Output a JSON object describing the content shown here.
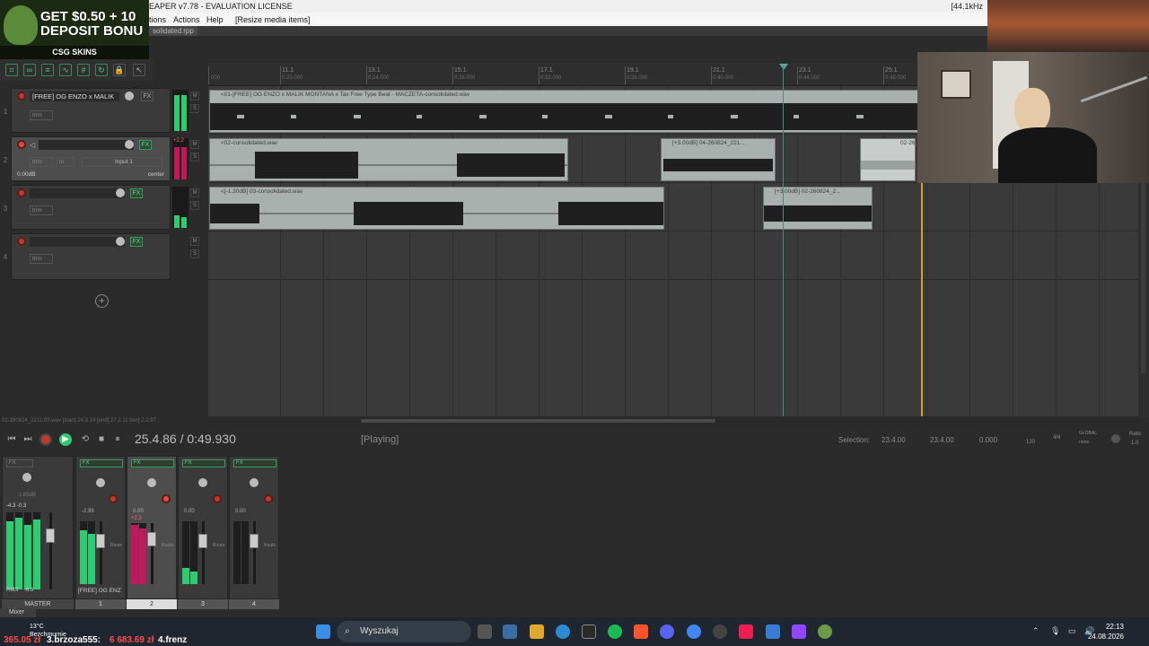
{
  "window": {
    "title": "EAPER v7.78 - EVALUATION LICENSE",
    "sample_rate": "[44.1kHz"
  },
  "menu": {
    "items": [
      "tions",
      "Actions",
      "Help",
      "[Resize media items]"
    ]
  },
  "project_tab": "solidated.rpp",
  "ad": {
    "line1": "GET $0.50 + 10",
    "line2": "DEPOSIT BONU",
    "brand": "CSG SKINS"
  },
  "ruler": {
    "marks": [
      {
        "label": "",
        "time": "000"
      },
      {
        "label": "11.1",
        "time": "0:20.000"
      },
      {
        "label": "13.1",
        "time": "0:24.000"
      },
      {
        "label": "15.1",
        "time": "0:28.000"
      },
      {
        "label": "17.1",
        "time": "0:32.000"
      },
      {
        "label": "19.1",
        "time": "0:36.000"
      },
      {
        "label": "21.1",
        "time": "0:40.000"
      },
      {
        "label": "23.1",
        "time": "0:44.000"
      },
      {
        "label": "25.1",
        "time": "0:48.000"
      }
    ]
  },
  "tracks": [
    {
      "num": "1",
      "name": "[FREE] OG ENZO x MALIK",
      "volume": "",
      "pan": "",
      "input": "",
      "trim": "trim",
      "fx": "FX"
    },
    {
      "num": "2",
      "name": "",
      "volume": "0.00dB",
      "pan": "center",
      "input": "Input 1",
      "trim": "trim",
      "fx": "FX",
      "meter_peak": "+2.2"
    },
    {
      "num": "3",
      "name": "",
      "volume": "",
      "pan": "",
      "input": "",
      "trim": "trim",
      "fx": "FX"
    },
    {
      "num": "4",
      "name": "",
      "volume": "",
      "pan": "",
      "input": "",
      "trim": "trim",
      "fx": "FX"
    }
  ],
  "items": [
    {
      "name": "<01-[FREE] OG ENZO x MALIK MONTANA x Tax Free Type Beat - MACZETA-consolidated.wav"
    },
    {
      "name": "<02-consolidated.wav"
    },
    {
      "name": "[+3.00dB] 04-260824_221..."
    },
    {
      "name": "02-26"
    },
    {
      "name": "<[-1.30dB] 03-consolidated.wav"
    },
    {
      "name": "[+3.00dB] 02-260824_2..."
    }
  ],
  "transport": {
    "position": "25.4.86 / 0:49.930",
    "status": "[Playing]",
    "selection_label": "Selection:",
    "selection_start": "23.4.00",
    "selection_end": "23.4.00",
    "selection_length": "0.000",
    "bpm": "120",
    "timesig": "4/4",
    "global_label": "GLOBAL",
    "global_value": "none",
    "rate_label": "Rate:",
    "rate_value": "1.0",
    "footer_info": "02-260824_2211-03.wav [start] 24.3.14 [end] 27.2.11 [len] 2.2.97"
  },
  "mixer": {
    "master_label": "MASTER",
    "master_rms": "RMS",
    "master_rms_value": "-6.9",
    "master_peaks": "-4.3   -0.3",
    "master_vol": "-1.65dB",
    "strips": [
      {
        "num": "1",
        "vol": "-2.99",
        "label": "[FREE] OG ENZ",
        "fx": "FX"
      },
      {
        "num": "2",
        "vol": "0.00",
        "peak": "+2.2",
        "fx": "FX"
      },
      {
        "num": "3",
        "vol": "0.00",
        "fx": "FX"
      },
      {
        "num": "4",
        "vol": "0.00",
        "fx": "FX"
      }
    ],
    "route": "Route",
    "tab": "Mixer"
  },
  "taskbar": {
    "search": "Wyszukaj",
    "time": "22:13",
    "date": "24.08.2026",
    "weather_temp": "13°C",
    "weather_desc": "Bezchmurnie"
  },
  "donation": {
    "rank2_value": "365.05 zł",
    "rank3": "3.brzoza555:",
    "rank3_value": "6 683.69 zł",
    "rank4": "4.frenz"
  },
  "colors": {
    "item_bg": "#a9b0ad",
    "accent_green": "#2ecc71",
    "record_red": "#c0392b",
    "edit_cursor": "#c9a83a"
  }
}
